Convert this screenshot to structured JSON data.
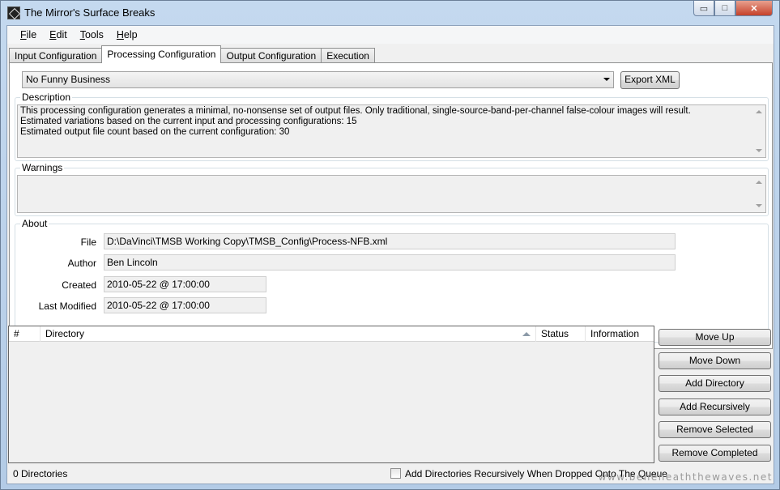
{
  "window": {
    "title": "The Mirror's Surface Breaks",
    "controls": {
      "minimize": "▭",
      "maximize": "□",
      "close": "✕"
    }
  },
  "menu": [
    {
      "label": "File",
      "mnemonic": "F",
      "rest": "ile"
    },
    {
      "label": "Edit",
      "mnemonic": "E",
      "rest": "dit"
    },
    {
      "label": "Tools",
      "mnemonic": "T",
      "rest": "ools"
    },
    {
      "label": "Help",
      "mnemonic": "H",
      "rest": "elp"
    }
  ],
  "tabs": [
    {
      "label": "Input Configuration",
      "active": false
    },
    {
      "label": "Processing Configuration",
      "active": true
    },
    {
      "label": "Output Configuration",
      "active": false
    },
    {
      "label": "Execution",
      "active": false
    }
  ],
  "processing": {
    "selected_config": "No Funny Business",
    "export_button": "Export XML",
    "description": {
      "label": "Description",
      "lines": [
        "This processing configuration generates a minimal, no-nonsense set of output files. Only traditional, single-source-band-per-channel false-colour images will result.",
        "Estimated variations based on the current input and processing configurations: 15",
        "Estimated output file count based on the current configuration: 30"
      ]
    },
    "warnings": {
      "label": "Warnings",
      "text": ""
    },
    "about": {
      "label": "About",
      "file_label": "File",
      "file_value": "D:\\DaVinci\\TMSB Working Copy\\TMSB_Config\\Process-NFB.xml",
      "author_label": "Author",
      "author_value": "Ben Lincoln",
      "created_label": "Created",
      "created_value": "2010-05-22 @ 17:00:00",
      "modified_label": "Last Modified",
      "modified_value": "2010-05-22 @ 17:00:00"
    }
  },
  "queue": {
    "columns": [
      "#",
      "Directory",
      "Status",
      "Information"
    ],
    "rows": [],
    "buttons": {
      "move_up": "Move Up",
      "move_down": "Move Down",
      "add_directory": "Add Directory",
      "add_recursively": "Add Recursively",
      "remove_selected": "Remove Selected",
      "remove_completed": "Remove Completed"
    },
    "count_text": "0 Directories",
    "recursive_checkbox_label": "Add Directories Recursively When Dropped Onto The Queue",
    "recursive_checked": false
  },
  "watermark": "www.beneneaththewaves.net"
}
